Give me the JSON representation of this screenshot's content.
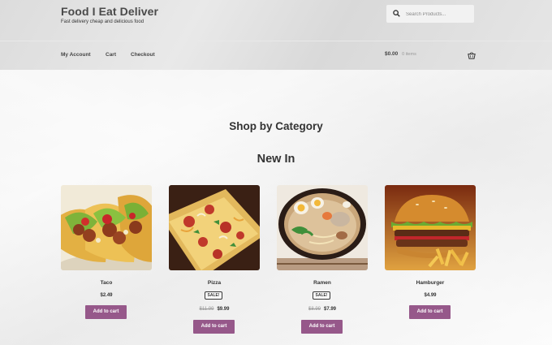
{
  "site": {
    "title": "Food I Eat Deliver",
    "tagline": "Fast delivery cheap and delicious food"
  },
  "search": {
    "placeholder": "Search Products..."
  },
  "nav": {
    "items": [
      "My Account",
      "Cart",
      "Checkout"
    ]
  },
  "cart": {
    "total": "$0.00",
    "count": "0 items"
  },
  "sections": {
    "category_heading": "Shop by Category",
    "new_heading": "New In"
  },
  "products": [
    {
      "name": "Taco",
      "price": "$2.49",
      "button": "Add to cart"
    },
    {
      "name": "Pizza",
      "badge": "SALE!",
      "old_price": "$11.99",
      "price": "$9.99",
      "button": "Add to cart"
    },
    {
      "name": "Ramen",
      "badge": "SALE!",
      "old_price": "$8.99",
      "price": "$7.99",
      "button": "Add to cart"
    },
    {
      "name": "Hamburger",
      "price": "$4.99",
      "button": "Add to cart"
    }
  ],
  "colors": {
    "button": "#96588a",
    "header": "#e0e0e0"
  }
}
